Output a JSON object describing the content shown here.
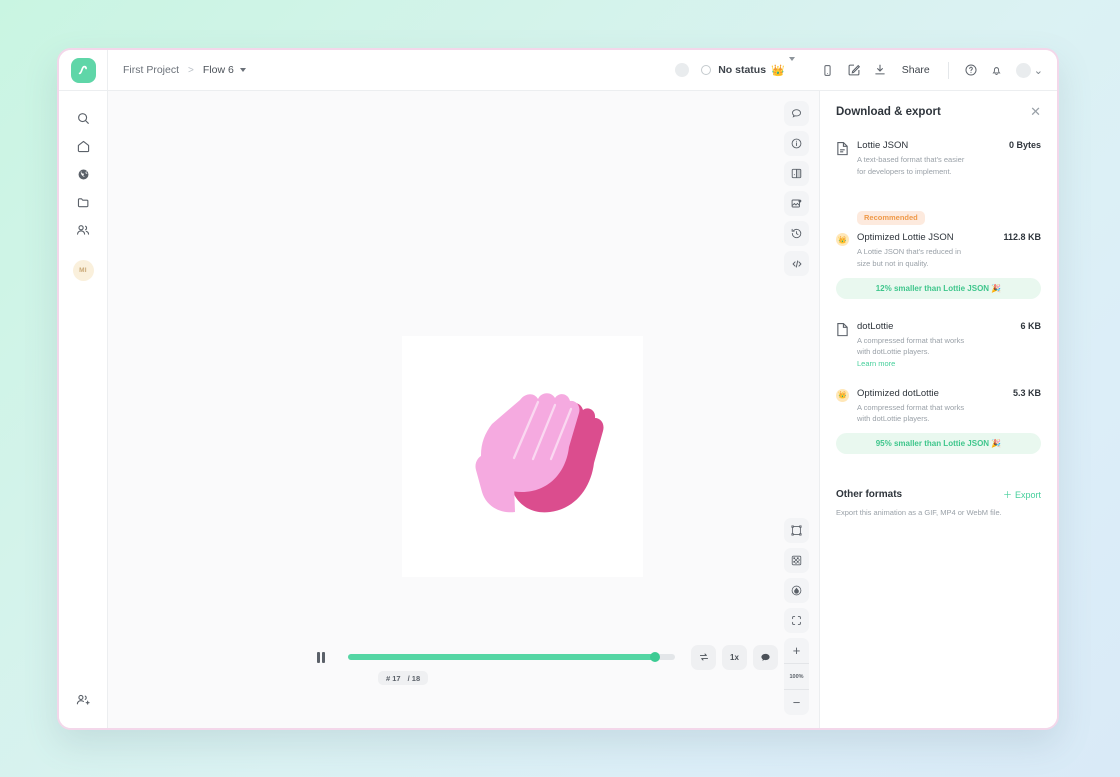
{
  "theme": {
    "page_bg_start": "#c9f5e2",
    "page_bg_end": "#d9eaf7",
    "window_border": "#f3d7ea",
    "accent_green": "#45cf9b",
    "player_green": "#54d6a4",
    "recommended_orange": "#ef9a4a",
    "recommended_bg": "#fdeade",
    "saving_bg": "#e9f8ef",
    "logo_green": "#5fd6a8",
    "avatar_bg": "#faf0dc"
  },
  "header": {
    "logo_icon": "lottiefiles-logo-icon",
    "breadcrumb": {
      "project": "First Project",
      "separator": ">",
      "flow": "Flow 6"
    },
    "status": {
      "label": "No status",
      "crown_icon": "crown-emoji",
      "ring_icon": "status-ring-icon",
      "caret_icon": "chevron-down-icon"
    },
    "actions": {
      "phone_icon": "phone-preview-icon",
      "edit_icon": "edit-pencil-icon",
      "download_icon": "download-icon",
      "share_label": "Share",
      "help_icon": "help-circle-icon",
      "bell_icon": "notification-bell-icon",
      "avatar_icon": "user-avatar",
      "chevron_icon": "chevron-down-icon"
    }
  },
  "sidebar": {
    "items": [
      {
        "icon": "search-icon",
        "name": "search"
      },
      {
        "icon": "home-icon",
        "name": "home"
      },
      {
        "icon": "globe-icon",
        "name": "discover"
      },
      {
        "icon": "folder-icon",
        "name": "projects"
      },
      {
        "icon": "people-icon",
        "name": "teams"
      }
    ],
    "workspace_avatar": "MI",
    "bottom_icon": "add-person-icon"
  },
  "canvas": {
    "top_tools": [
      {
        "icon": "comment-icon",
        "name": "comment"
      },
      {
        "icon": "info-icon",
        "name": "info"
      },
      {
        "icon": "layers-icon",
        "name": "layers"
      },
      {
        "icon": "image-icon",
        "name": "image"
      },
      {
        "icon": "history-icon",
        "name": "version-history"
      },
      {
        "icon": "code-icon",
        "name": "embed-code"
      }
    ],
    "bottom_tools": [
      {
        "icon": "bounding-box-icon",
        "name": "bounding-box"
      },
      {
        "icon": "checkerboard-icon",
        "name": "transparency-grid"
      },
      {
        "icon": "droplet-icon",
        "name": "background-color"
      },
      {
        "icon": "fit-frame-icon",
        "name": "fit-to-frame"
      }
    ],
    "zoom": {
      "in_icon": "plus-icon",
      "level": "100%",
      "out_icon": "minus-icon"
    },
    "animation": {
      "name": "clapping-hands-animation",
      "front_hand_color": "#f5aae0",
      "back_hand_color": "#db4d8e"
    }
  },
  "player": {
    "state_icon": "pause-icon",
    "progress_percent": 94,
    "frame_current": "# 17",
    "frame_total": "/ 18",
    "loop_icon": "loop-icon",
    "speed_label": "1x",
    "comment_icon": "comment-filled-icon"
  },
  "panel": {
    "title": "Download & export",
    "close_icon": "close-icon",
    "formats": [
      {
        "icon": "file-icon",
        "name": "Lottie JSON",
        "size": "0 Bytes",
        "description": "A text-based format that's easier for developers to implement.",
        "badge": null,
        "saving": null,
        "learn_more": null
      },
      {
        "icon": "crown-badge-icon",
        "name": "Optimized Lottie JSON",
        "size": "112.8 KB",
        "description": "A Lottie JSON that's reduced in size but not in quality.",
        "badge": "Recommended",
        "saving": "12% smaller than Lottie JSON 🎉",
        "learn_more": null
      },
      {
        "icon": "file-icon",
        "name": "dotLottie",
        "size": "6 KB",
        "description": "A compressed format that works with dotLottie players.",
        "badge": null,
        "saving": null,
        "learn_more": "Learn more"
      },
      {
        "icon": "crown-badge-icon",
        "name": "Optimized dotLottie",
        "size": "5.3 KB",
        "description": "A compressed format that works with dotLottie players.",
        "badge": null,
        "saving": "95% smaller than Lottie JSON 🎉",
        "learn_more": null
      }
    ],
    "other_formats": {
      "title": "Other formats",
      "export_label": "Export",
      "export_icon": "plus-icon",
      "description": "Export this animation as a GIF, MP4 or WebM file."
    }
  }
}
